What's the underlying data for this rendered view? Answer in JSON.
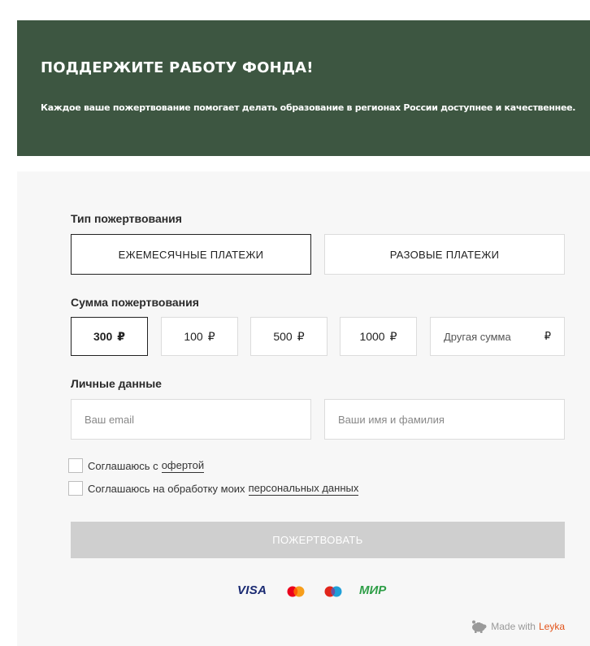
{
  "banner": {
    "title": "ПОДДЕРЖИТЕ РАБОТУ ФОНДА!",
    "subtitle": "Каждое ваше пожертвование помогает делать образование в регионах России доступнее и качественнее.",
    "background_color": "#3d5641"
  },
  "form": {
    "type_label": "Тип пожертвования",
    "tabs": [
      {
        "label": "ЕЖЕМЕСЯЧНЫЕ ПЛАТЕЖИ",
        "selected": true
      },
      {
        "label": "РАЗОВЫЕ ПЛАТЕЖИ",
        "selected": false
      }
    ],
    "amount_label": "Сумма пожертвования",
    "currency": "₽",
    "amounts": [
      {
        "value": "300",
        "selected": true
      },
      {
        "value": "100",
        "selected": false
      },
      {
        "value": "500",
        "selected": false
      },
      {
        "value": "1000",
        "selected": false
      }
    ],
    "custom_amount_placeholder": "Другая сумма",
    "personal_label": "Личные данные",
    "email_placeholder": "Ваш email",
    "name_placeholder": "Ваши имя и фамилия",
    "agree_offer_text": "Соглашаюсь с",
    "agree_offer_link": "офертой",
    "agree_personal_text": "Соглашаюсь на обработку моих",
    "agree_personal_link": "персональных данных",
    "submit_label": "ПОЖЕРТВОВАТЬ"
  },
  "payment_icons": {
    "visa": "VISA",
    "mastercard": "mastercard-icon",
    "maestro": "maestro-icon",
    "mir": "МИР"
  },
  "footer": {
    "made_with": "Made with",
    "brand": "Leyka",
    "brand_color": "#e2531a"
  }
}
